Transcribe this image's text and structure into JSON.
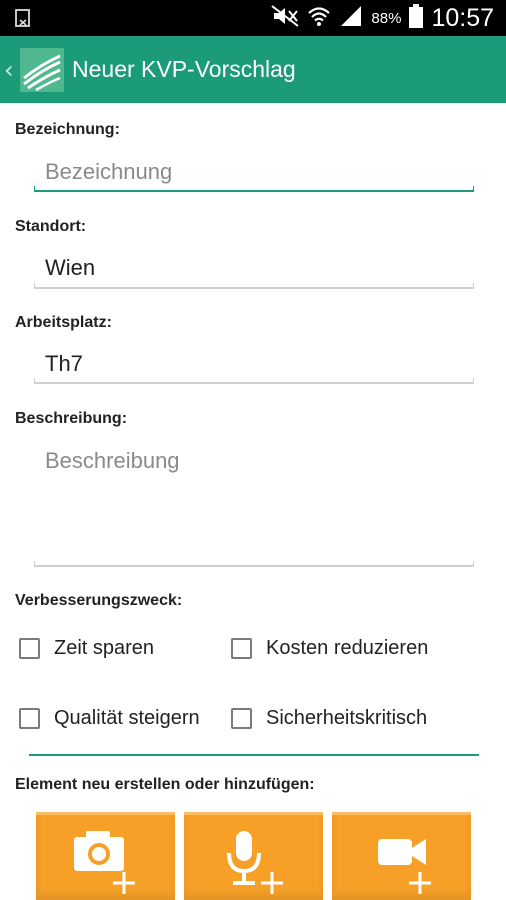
{
  "status_bar": {
    "battery_percent": "88%",
    "time": "10:57"
  },
  "app_bar": {
    "title": "Neuer KVP-Vorschlag",
    "back_icon": "chevron-left-icon",
    "logo_icon": "app-logo-icon",
    "background": "#1b9b7a"
  },
  "form": {
    "bezeichnung": {
      "label": "Bezeichnung:",
      "placeholder": "Bezeichnung",
      "value": ""
    },
    "standort": {
      "label": "Standort:",
      "value": "Wien"
    },
    "arbeitsplatz": {
      "label": "Arbeitsplatz:",
      "value": "Th7"
    },
    "beschreibung": {
      "label": "Beschreibung:",
      "placeholder": "Beschreibung",
      "value": ""
    }
  },
  "purpose": {
    "label": "Verbesserungszweck:",
    "options": [
      {
        "label": "Zeit sparen",
        "checked": false
      },
      {
        "label": "Kosten reduzieren",
        "checked": false
      },
      {
        "label": "Qualität steigern",
        "checked": false
      },
      {
        "label": "Sicherheitskritisch",
        "checked": false
      }
    ]
  },
  "attachments": {
    "label": "Element neu erstellen oder hinzufügen:",
    "buttons": [
      {
        "icon": "camera-plus-icon"
      },
      {
        "icon": "microphone-plus-icon"
      },
      {
        "icon": "video-plus-icon"
      }
    ],
    "color": "#f6a028"
  }
}
